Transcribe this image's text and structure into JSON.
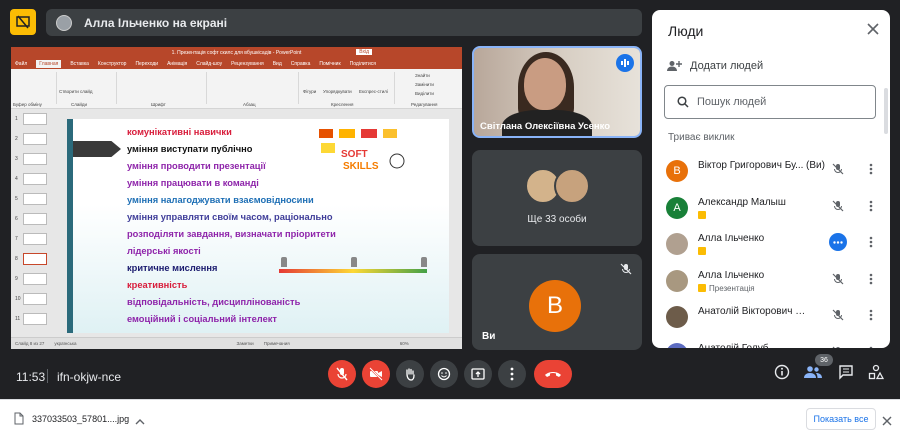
{
  "topbar": {
    "presenter_label": "Алла Ільченко на екрані"
  },
  "presentation": {
    "window_title": "1. Презентація софт скилс для вбушкісадів - PowerPoint",
    "enter_label": "Вхід",
    "ribbon_tabs": [
      "Файл",
      "Главная",
      "Вставка",
      "Конструктор",
      "Переходи",
      "Анімація",
      "Слайд-шоу",
      "Рецензування",
      "Вид",
      "Справка",
      "Помічник",
      "Поділитися"
    ],
    "active_tab": "Главная",
    "ribbon_groups": [
      "Буфер обміну",
      "Слайди",
      "Шрифт",
      "Абзац",
      "Креслення",
      "Редагування"
    ],
    "ribbon_labels": [
      "Створити слайд",
      "Фігури",
      "Упорядкувати",
      "Експрес-стилі",
      "Знайти",
      "Замінити",
      "Виділити"
    ],
    "slide_lines": [
      {
        "text": "комунікативні навички",
        "color": "#d81b3a"
      },
      {
        "text": "уміння виступати публічно",
        "color": "#111111"
      },
      {
        "text": "уміння проводити презентації",
        "color": "#8e24aa"
      },
      {
        "text": "уміння працювати в команді",
        "color": "#8e24aa"
      },
      {
        "text": "уміння налагоджувати взаємовідносини",
        "color": "#1e6fb5"
      },
      {
        "text": "уміння управляти своїм часом, раціонально",
        "color": "#3f3d99"
      },
      {
        "text": "розподіляти завдання, визначати пріоритети",
        "color": "#8e24aa"
      },
      {
        "text": "лідерські якості",
        "color": "#8e24aa"
      },
      {
        "text": "критичне мислення",
        "color": "#1a1a6e"
      },
      {
        "text": "креативність",
        "color": "#d81b3a"
      },
      {
        "text": "відповідальність, дисциплінованість",
        "color": "#8e24aa"
      },
      {
        "text": "емоційний і соціальний інтелект",
        "color": "#8e24aa"
      }
    ],
    "slide_logo_text": "SOFT SKILLS",
    "thumb_numbers": [
      "1",
      "2",
      "3",
      "4",
      "5",
      "6",
      "7",
      "8",
      "9",
      "10",
      "11"
    ],
    "status_left": "Слайд 8 из 27",
    "status_lang": "українська",
    "status_notes": "Заметки",
    "status_comments": "Примечания",
    "zoom": "60%"
  },
  "tiles": {
    "speaker_name": "Світлана Олексіївна Усенко",
    "more_label": "Ще 33 особи",
    "you_initial": "В",
    "you_label": "Ви"
  },
  "people": {
    "title": "Люди",
    "add_label": "Додати людей",
    "search_placeholder": "Пошук людей",
    "section": "Триває виклик",
    "list": [
      {
        "initial": "В",
        "name": "Віктор Григорович Бу...",
        "you": "(Ви)",
        "color": "#e8710a",
        "sub": ""
      },
      {
        "initial": "А",
        "name": "Александр Малыш",
        "you": "",
        "color": "#188038",
        "sub": ""
      },
      {
        "initial": "",
        "name": "Алла Ільченко",
        "you": "",
        "color": "#b0a090",
        "sub": ""
      },
      {
        "initial": "",
        "name": "Алла Ільченко",
        "you": "",
        "color": "#a89880",
        "sub": "Презентація"
      },
      {
        "initial": "",
        "name": "Анатолій Вікторович Ант...",
        "you": "",
        "color": "#6d5c4a",
        "sub": ""
      },
      {
        "initial": "А",
        "name": "Анатолій Голуб",
        "you": "",
        "color": "#5c6bc0",
        "sub": ""
      }
    ]
  },
  "bottombar": {
    "time": "11:53",
    "meeting_code": "ifn-okjw-nce",
    "participant_count": "36"
  },
  "downloads": {
    "file_name": "337033503_57801....jpg",
    "show_all": "Показать все"
  },
  "colors": {
    "meet_bg": "#202124",
    "danger": "#ea4335",
    "accent": "#1a73e8",
    "present_yellow": "#fbbc04",
    "ppt_red": "#b7472a"
  }
}
